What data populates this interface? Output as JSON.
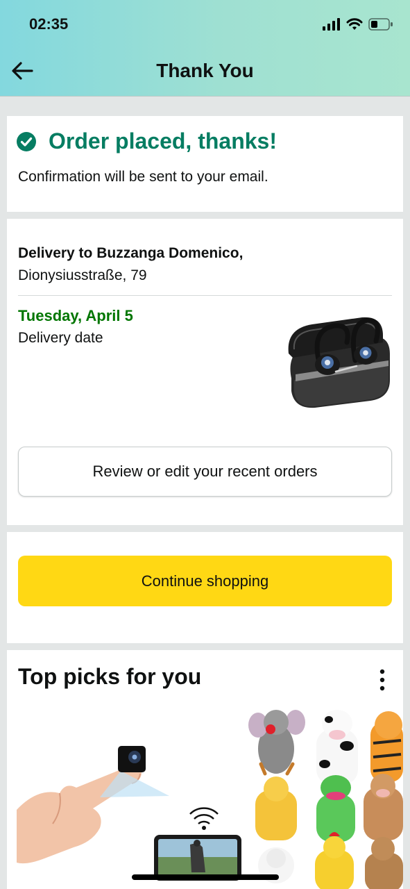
{
  "status_bar": {
    "time": "02:35"
  },
  "header": {
    "title": "Thank You"
  },
  "confirmation": {
    "title": "Order placed, thanks!",
    "subtitle": "Confirmation will be sent to your email."
  },
  "delivery": {
    "recipient": "Delivery to Buzzanga Domenico,",
    "address": "Dionysiusstraße, 79",
    "date": "Tuesday, April 5",
    "date_label": "Delivery date",
    "review_button": "Review or edit your recent orders"
  },
  "continue": {
    "button": "Continue shopping"
  },
  "top_picks": {
    "title": "Top picks for you"
  },
  "colors": {
    "success_green": "#067d62",
    "date_green": "#007600",
    "primary_yellow": "#ffd814"
  }
}
